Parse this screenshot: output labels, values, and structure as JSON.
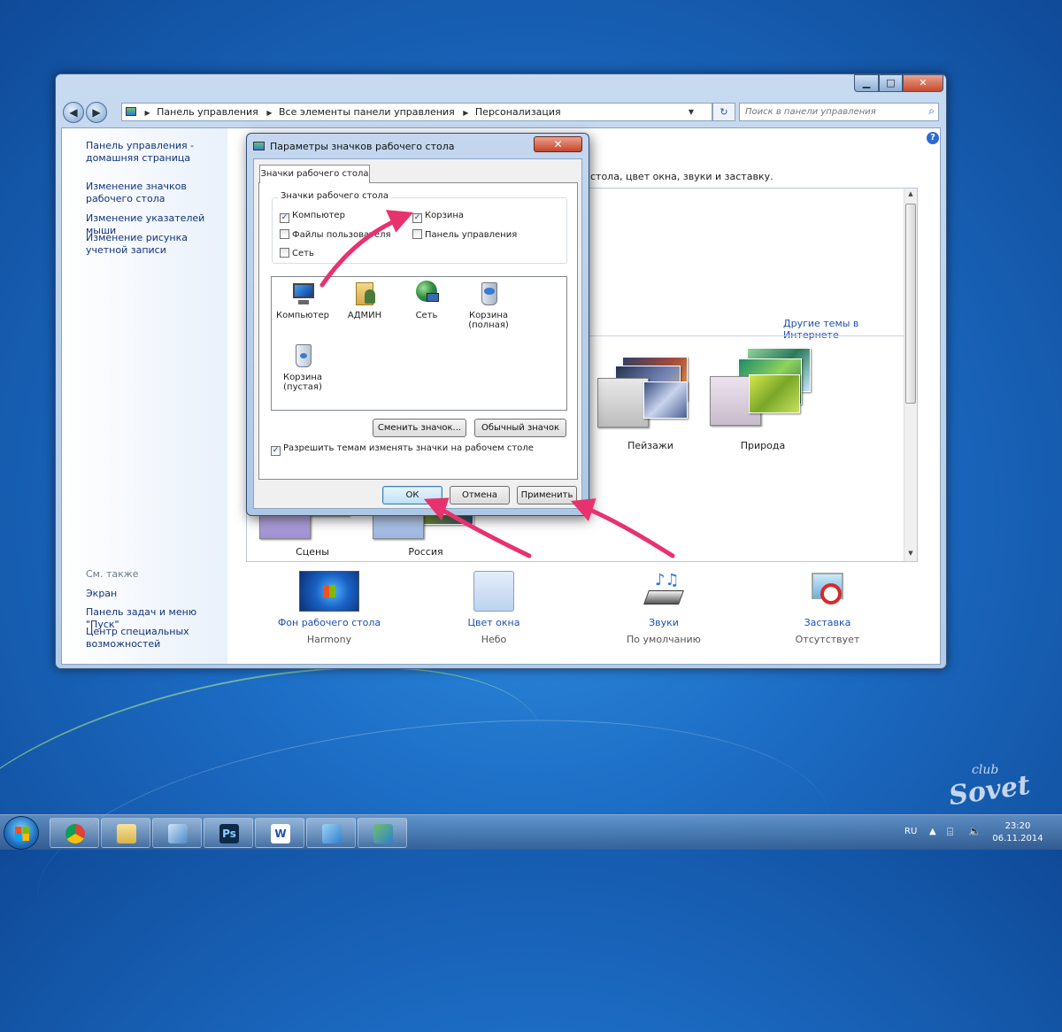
{
  "window": {
    "address_crumbs": [
      "Панель управления",
      "Все элементы панели управления",
      "Персонализация"
    ],
    "search_placeholder": "Поиск в панели управления"
  },
  "sidebar": {
    "links": [
      "Панель управления - домашняя страница",
      "Изменение значков рабочего стола",
      "Изменение указателей мыши",
      "Изменение рисунка учетной записи"
    ],
    "see_also_title": "См. также",
    "see_also": [
      "Экран",
      "Панель задач и меню \"Пуск\"",
      "Центр специальных возможностей"
    ]
  },
  "main": {
    "intro_text": "стола, цвет окна, звуки и заставку.",
    "more_themes_link": "Другие темы в Интернете",
    "themes": [
      "Пейзажи",
      "Природа",
      "Сцены",
      "Россия"
    ],
    "bottom": [
      {
        "label": "Фон рабочего стола",
        "value": "Harmony"
      },
      {
        "label": "Цвет окна",
        "value": "Небо"
      },
      {
        "label": "Звуки",
        "value": "По умолчанию"
      },
      {
        "label": "Заставка",
        "value": "Отсутствует"
      }
    ]
  },
  "dialog": {
    "title": "Параметры значков рабочего стола",
    "tab": "Значки рабочего стола",
    "group_title": "Значки рабочего стола",
    "checkboxes": [
      {
        "label": "Компьютер",
        "checked": true
      },
      {
        "label": "Корзина",
        "checked": true
      },
      {
        "label": "Файлы пользователя",
        "checked": false
      },
      {
        "label": "Панель управления",
        "checked": false
      },
      {
        "label": "Сеть",
        "checked": false
      }
    ],
    "icons": [
      "Компьютер",
      "АДМИН",
      "Сеть",
      "Корзина (полная)",
      "Корзина (пустая)"
    ],
    "change_icon": "Сменить значок...",
    "default_icon": "Обычный значок",
    "allow_themes": "Разрешить темам изменять значки на рабочем столе",
    "allow_themes_checked": true,
    "ok": "ОК",
    "cancel": "Отмена",
    "apply": "Применить"
  },
  "taskbar": {
    "lang": "RU",
    "time": "23:20",
    "date": "06.11.2014",
    "apps": [
      "chrome-icon",
      "explorer-icon",
      "photo-viewer-icon",
      "photoshop-icon",
      "word-icon",
      "control-panel-icon",
      "personalization-icon"
    ],
    "ps_label": "Ps",
    "word_label": "W"
  },
  "watermark": {
    "top": "club",
    "main": "Sovet"
  },
  "colors": {
    "accent": "#1e4fb4",
    "arrow": "#e8326e"
  }
}
